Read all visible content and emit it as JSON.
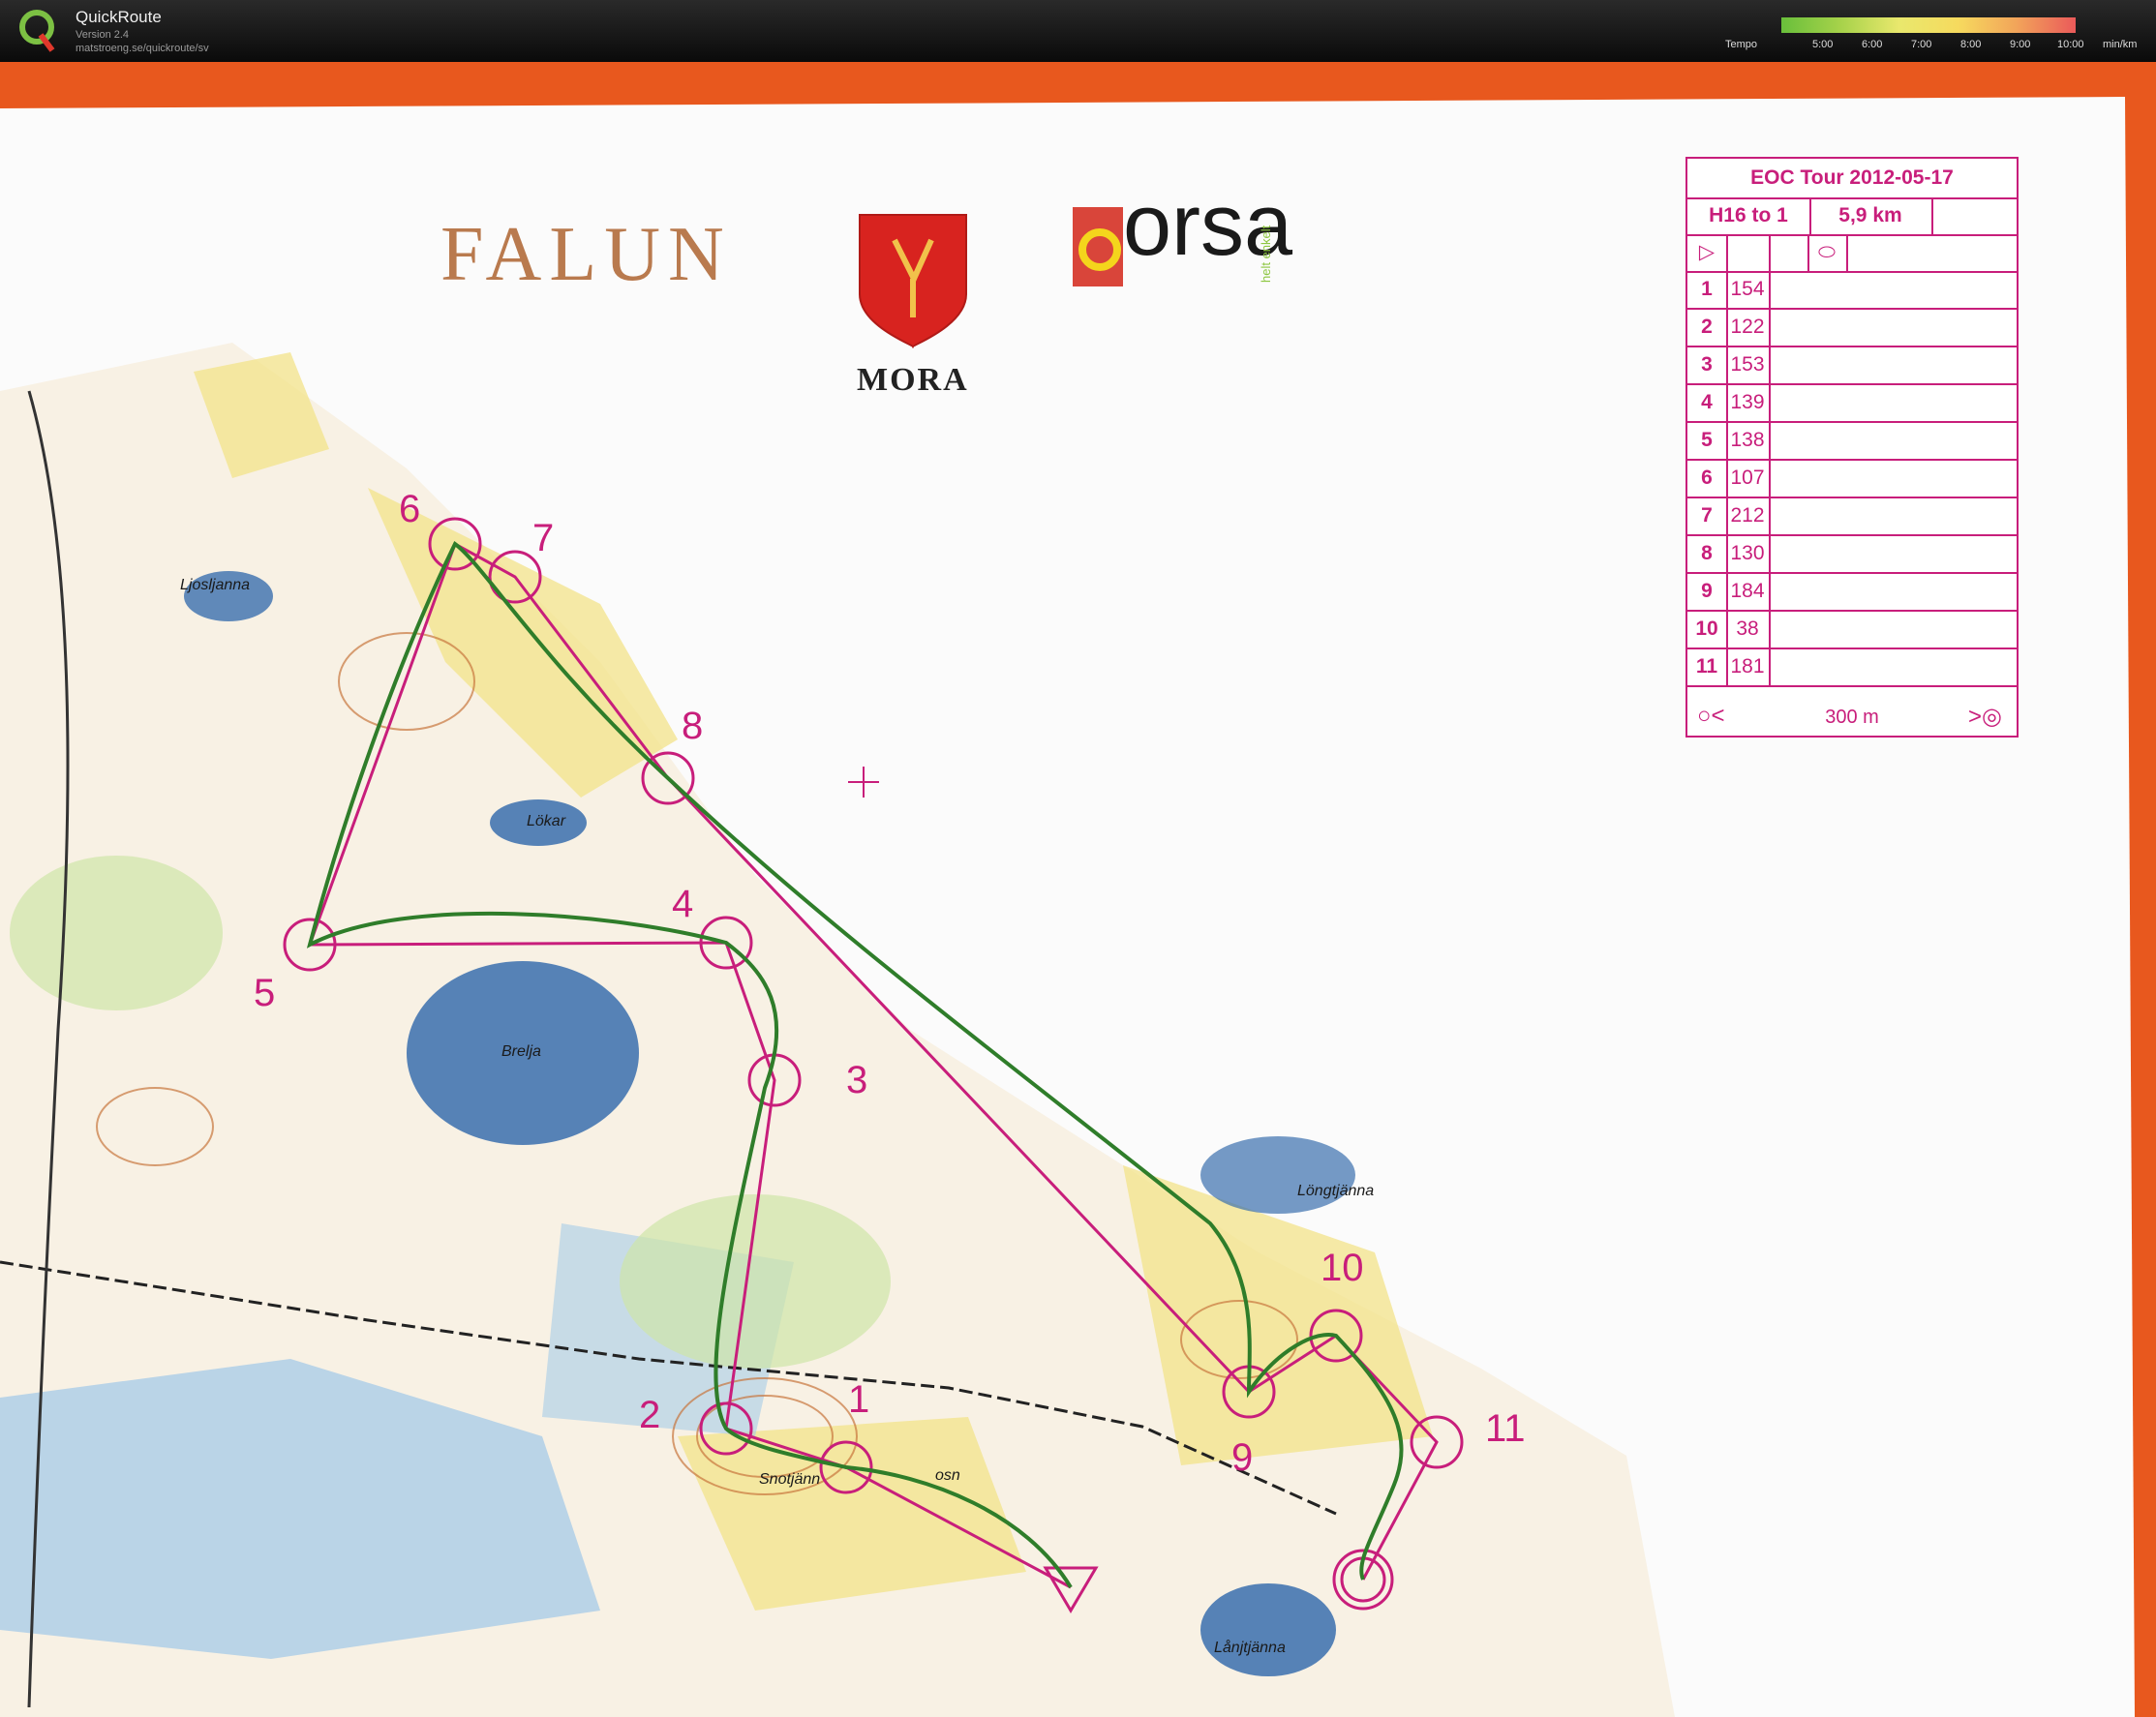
{
  "app": {
    "title": "QuickRoute",
    "version": "Version 2.4",
    "url": "matstroeng.se/quickroute/sv"
  },
  "tempo": {
    "label": "Tempo",
    "ticks": [
      "5:00",
      "6:00",
      "7:00",
      "8:00",
      "9:00",
      "10:00"
    ],
    "unit": "min/km",
    "colors": [
      "#69bf3b",
      "#a6d24a",
      "#e9e86d",
      "#f6da5e",
      "#f2a45a",
      "#ea5a5a"
    ]
  },
  "sponsors": {
    "falun": "FALUN",
    "mora": "MORA",
    "orsa": "orsa",
    "orsa_tag": "helt enkelt"
  },
  "control_card": {
    "title": "EOC Tour 2012-05-17",
    "class": "H16 to 1",
    "length": "5,9 km",
    "rows": [
      {
        "num": "1",
        "code": "154"
      },
      {
        "num": "2",
        "code": "122"
      },
      {
        "num": "3",
        "code": "153"
      },
      {
        "num": "4",
        "code": "139"
      },
      {
        "num": "5",
        "code": "138"
      },
      {
        "num": "6",
        "code": "107"
      },
      {
        "num": "7",
        "code": "212"
      },
      {
        "num": "8",
        "code": "130"
      },
      {
        "num": "9",
        "code": "184"
      },
      {
        "num": "10",
        "code": "38"
      },
      {
        "num": "11",
        "code": "181"
      }
    ],
    "finish_distance": "300 m"
  },
  "map": {
    "place_names": [
      "Ljosljanna",
      "Lökar",
      "Brelja",
      "Snotjänn",
      "osn",
      "Löngtjänna",
      "Lånjtjänna"
    ],
    "controls": [
      "1",
      "2",
      "3",
      "4",
      "5",
      "6",
      "7",
      "8",
      "9",
      "10",
      "11"
    ],
    "colors": {
      "course": "#c81e7b",
      "route": "#2f7d2a",
      "water": "#9fc8e8",
      "lake": "#3a6fae",
      "open": "#f3e38a",
      "contour": "#c8763d",
      "frame": "#e8581e"
    }
  }
}
